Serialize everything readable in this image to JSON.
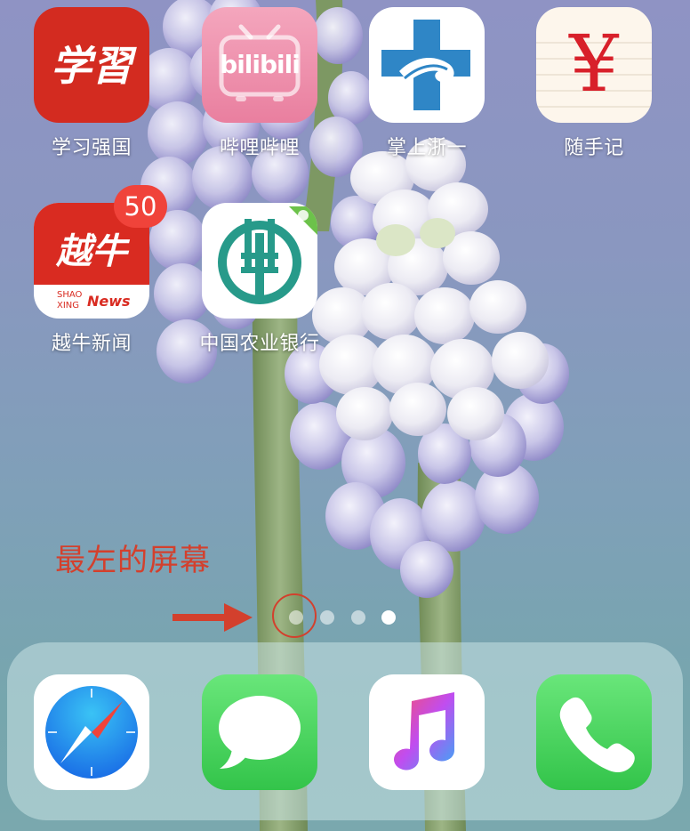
{
  "apps": [
    {
      "id": "xuexi",
      "label": "学习强国",
      "logo_text": "学習"
    },
    {
      "id": "bilibili",
      "label": "哔哩哔哩",
      "logo_text": "bilibili"
    },
    {
      "id": "zheyi",
      "label": "掌上浙一"
    },
    {
      "id": "suishouji",
      "label": "随手记",
      "logo_text": "¥"
    },
    {
      "id": "yueniu",
      "label": "越牛新闻",
      "logo_text": "越牛",
      "sub_text_1": "SHAO",
      "sub_text_2": "XING",
      "sub_text_3": "News",
      "badge": "50"
    },
    {
      "id": "abc",
      "label": "中国农业银行"
    }
  ],
  "annotation": {
    "text": "最左的屏幕",
    "color": "#d3402d"
  },
  "page_dots": {
    "count": 4,
    "current": 4
  },
  "dock": [
    {
      "id": "safari",
      "icon": "compass-icon"
    },
    {
      "id": "messages",
      "icon": "speech-bubble-icon"
    },
    {
      "id": "music",
      "icon": "music-note-icon"
    },
    {
      "id": "phone",
      "icon": "phone-handset-icon"
    }
  ],
  "colors": {
    "badge": "#f0433a",
    "xuexi": "#d32b20",
    "bilibili": "#ee8fab",
    "zheyi_cross": "#2f86c6",
    "suishouji_yen": "#d8202a",
    "yueniu": "#d92b21",
    "abc": "#279a8a",
    "messages": "#4dd964",
    "phone": "#4cd964"
  }
}
